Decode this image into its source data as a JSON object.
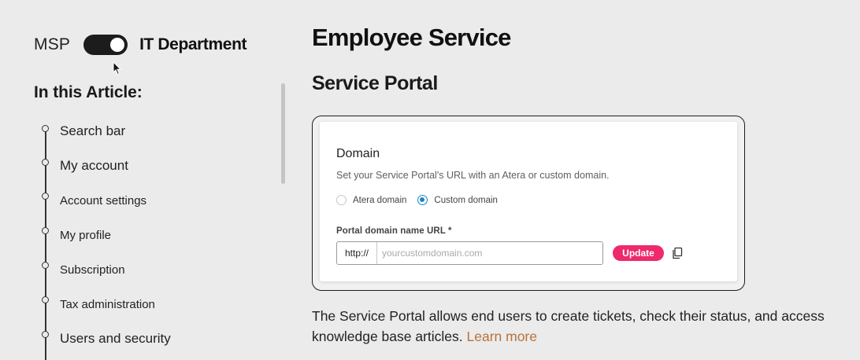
{
  "toggle": {
    "left_label": "MSP",
    "right_label": "IT Department",
    "state": "on"
  },
  "toc": {
    "title": "In this Article:",
    "items": [
      {
        "label": "Search bar"
      },
      {
        "label": "My account"
      },
      {
        "label": "Account settings"
      },
      {
        "label": "My profile"
      },
      {
        "label": "Subscription"
      },
      {
        "label": "Tax administration"
      },
      {
        "label": "Users and security"
      }
    ]
  },
  "main": {
    "page_title": "Employee Service",
    "section_title": "Service Portal",
    "domain_card": {
      "title": "Domain",
      "description": "Set your Service Portal's URL with an Atera or custom domain.",
      "options": [
        {
          "label": "Atera domain",
          "selected": false
        },
        {
          "label": "Custom domain",
          "selected": true
        }
      ],
      "field_label": "Portal domain name URL *",
      "url_prefix": "http://",
      "url_placeholder": "yourcustomdomain.com",
      "url_value": "",
      "update_label": "Update",
      "copy_icon": "copy-icon"
    },
    "body_text": "The Service Portal allows end users to create tickets, check their status, and access knowledge base articles. ",
    "learn_more": "Learn more"
  },
  "colors": {
    "background": "#ebebeb",
    "accent_pink": "#ee2a6b",
    "radio_blue": "#1d86c7",
    "link": "#b8733a"
  }
}
